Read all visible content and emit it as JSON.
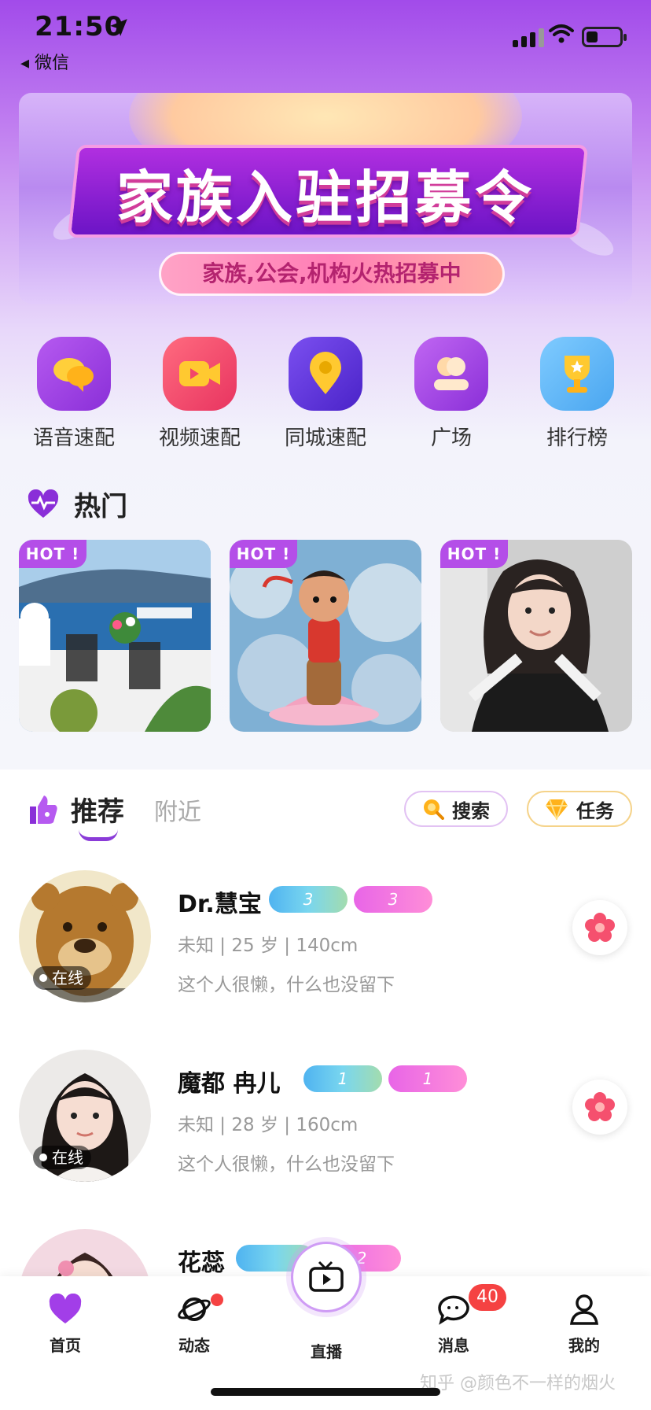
{
  "status_bar": {
    "time": "21:50",
    "back_app": "◂ 微信"
  },
  "banner": {
    "title": "家族入驻招募令",
    "subtitle": "家族,公会,机构火热招募中"
  },
  "quick_menu": [
    {
      "label": "语音速配",
      "icon": "chat-bubbles-icon",
      "color": "#9b3fe0"
    },
    {
      "label": "视频速配",
      "icon": "video-camera-icon",
      "color": "#f2466b"
    },
    {
      "label": "同城速配",
      "icon": "location-pin-icon",
      "color": "#6a3fe0"
    },
    {
      "label": "广场",
      "icon": "plaza-icon",
      "color": "#a142e8"
    },
    {
      "label": "排行榜",
      "icon": "trophy-icon",
      "color": "#5ab6f7"
    }
  ],
  "hot": {
    "title": "热门",
    "tag": "HOT !",
    "cards": [
      "seaside-terrace",
      "cartoon-boy-on-lotus",
      "girl-selfie"
    ]
  },
  "recommend": {
    "tab_active": "推荐",
    "tab_other": "附近",
    "search_label": "搜索",
    "task_label": "任务",
    "online_label": "在线",
    "users": [
      {
        "name": "Dr.慧宝",
        "diamond": "3",
        "heart": "3",
        "info": "未知 | 25 岁 | 140cm",
        "signature": "这个人很懒，什么也没留下",
        "online": true
      },
      {
        "name": "魔都  冉儿",
        "diamond": "1",
        "heart": "1",
        "info": "未知 | 28 岁 | 160cm",
        "signature": "这个人很懒，什么也没留下",
        "online": true
      },
      {
        "name": "花蕊",
        "diamond": "",
        "heart": "2",
        "info": "",
        "signature": "",
        "online": false
      }
    ]
  },
  "bottom_nav": {
    "items": [
      {
        "label": "首页",
        "icon": "heart-icon"
      },
      {
        "label": "动态",
        "icon": "planet-icon"
      },
      {
        "label": "直播",
        "icon": "tv-icon"
      },
      {
        "label": "消息",
        "icon": "message-icon"
      },
      {
        "label": "我的",
        "icon": "user-icon"
      }
    ],
    "message_count": "40"
  },
  "watermark": "知乎 @颜色不一样的烟火",
  "colors": {
    "accent": "#9b3fe0",
    "badge_red": "#f54242"
  }
}
